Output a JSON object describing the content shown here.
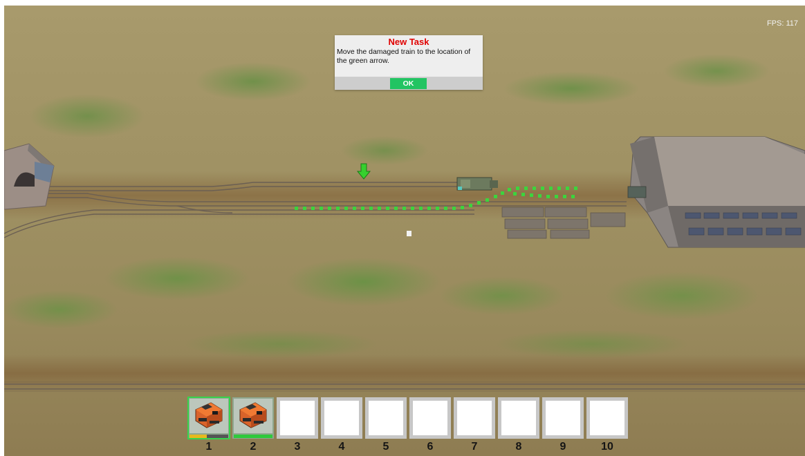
{
  "hud": {
    "fps_text": "FPS: 117"
  },
  "dialog": {
    "title": "New Task",
    "message": "Move the damaged train to the location of the green arrow.",
    "ok_label": "OK",
    "title_color": "#e00000",
    "button_color": "#22c462"
  },
  "scene": {
    "target_marker_icon": "green-down-arrow-icon",
    "damaged_train": "green-locomotive",
    "structures": [
      "tunnel-portal",
      "depot-building",
      "pallet-stacks"
    ]
  },
  "hotbar": {
    "slots": [
      {
        "number": "1",
        "icon": "orange-locomotive-icon",
        "health": 0.45,
        "health_color": "#e6b81e",
        "selected": true
      },
      {
        "number": "2",
        "icon": "orange-locomotive-icon",
        "health": 1.0,
        "health_color": "#2fc93c",
        "selected": false
      },
      {
        "number": "3",
        "icon": "",
        "health": null,
        "selected": false
      },
      {
        "number": "4",
        "icon": "",
        "health": null,
        "selected": false
      },
      {
        "number": "5",
        "icon": "",
        "health": null,
        "selected": false
      },
      {
        "number": "6",
        "icon": "",
        "health": null,
        "selected": false
      },
      {
        "number": "7",
        "icon": "",
        "health": null,
        "selected": false
      },
      {
        "number": "8",
        "icon": "",
        "health": null,
        "selected": false
      },
      {
        "number": "9",
        "icon": "",
        "health": null,
        "selected": false
      },
      {
        "number": "10",
        "icon": "",
        "health": null,
        "selected": false
      }
    ]
  }
}
